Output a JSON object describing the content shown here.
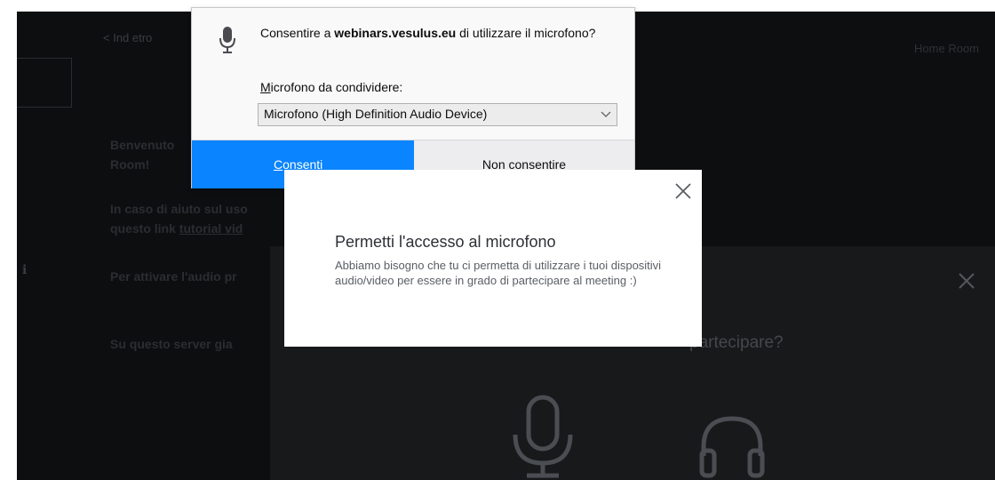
{
  "background": {
    "back_link": "< Ind etro",
    "right_link": "Home Room",
    "welcome_line1": "Benvenuto",
    "welcome_line2": "Room!",
    "help_line1": "In caso di aiuto sul uso",
    "help_line2_prefix": "questo link ",
    "help_line2_link": "tutorial vid",
    "audio_line": "Per attivare l'audio pr",
    "server_line": "Su questo server gia",
    "side_mark": "ℹ"
  },
  "audio_modal": {
    "title": "partecipare?",
    "close_icon": "close-icon",
    "mic_icon": "microphone-icon",
    "headphones_icon": "headphones-icon"
  },
  "permission_popup": {
    "prompt_prefix": "Consentire a ",
    "prompt_domain": "webinars.vesulus.eu",
    "prompt_suffix": " di utilizzare il microfono?",
    "share_label_accel": "M",
    "share_label_rest": "icrofono da condividere:",
    "selected_device": "Microfono (High Definition Audio Device)",
    "allow_accel": "C",
    "allow_rest": "onsenti",
    "deny_accel": "N",
    "deny_rest": "on consentire",
    "colors": {
      "allow_bg": "#0a84ff",
      "deny_bg": "#ededf0"
    }
  },
  "info_modal": {
    "title": "Permetti l'accesso al microfono",
    "body": "Abbiamo bisogno che tu ci permetta di utilizzare i tuoi dispositivi audio/video per essere in grado di partecipare al meeting :)"
  }
}
